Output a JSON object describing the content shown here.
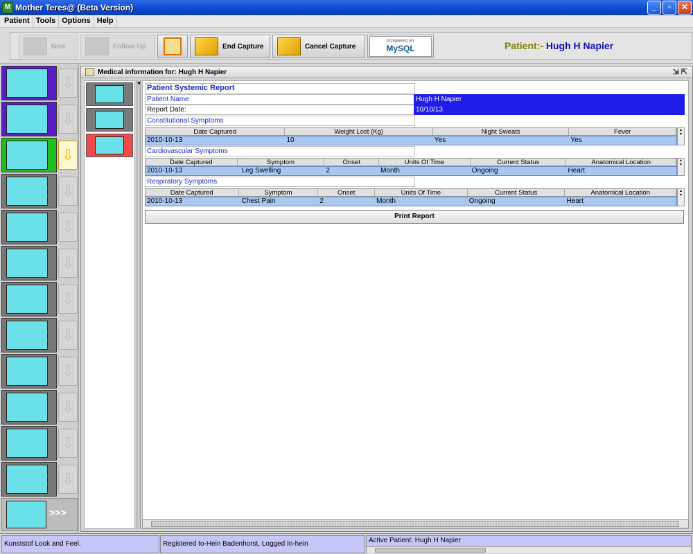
{
  "window": {
    "title": "Mother Teres@ (Beta Version)"
  },
  "menu": [
    "Patient",
    "Tools",
    "Options",
    "Help"
  ],
  "toolbar": {
    "new_label": "New",
    "follow_up_label": "Follow Up",
    "end_capture_label": "End Capture",
    "cancel_capture_label": "Cancel Capture",
    "mysql_powered": "POWERED BY",
    "mysql_label": "MySQL"
  },
  "patient_header": {
    "label": "Patient:-",
    "name": "Hugh H Napier"
  },
  "frame": {
    "title": "Medical information for: Hugh H Napier"
  },
  "report": {
    "title": "Patient Systemic Report",
    "patient_name_label": "Patient Name",
    "patient_name_value": "Hugh H Napier",
    "report_date_label": "Report Date:",
    "report_date_value": "10/10/13",
    "constitutional": {
      "label": "Constitutional Symptoms",
      "headers": [
        "Date Captured",
        "Weight Lost (Kg)",
        "Night Sweats",
        "Fever"
      ],
      "row": [
        "2010-10-13",
        "10",
        "Yes",
        "Yes"
      ]
    },
    "cardiovascular": {
      "label": "Cardiovascular Symptoms",
      "headers": [
        "Date Captured",
        "Symptom",
        "Onset",
        "Units Of Time",
        "Current Status",
        "Anatomical Location"
      ],
      "row": [
        "2010-10-13",
        "Leg Swelling",
        "2",
        "Month",
        "Ongoing",
        "Heart"
      ]
    },
    "respiratory": {
      "label": "Respiratory Symptoms",
      "headers": [
        "Date Captured",
        "Symptom",
        "Onset",
        "Units Of Time",
        "Current Status",
        "Anatomical Location"
      ],
      "row": [
        "2010-10-13",
        "Chest Pain",
        "2",
        "Month",
        "Ongoing",
        "Heart"
      ]
    },
    "print_label": "Print Report"
  },
  "nav": {
    "more_label": ">>>"
  },
  "status": {
    "look_and_feel": "Kunststof Look and Feel.",
    "registered": "Registered to-Hein Badenhorst, Logged In-hein",
    "active_patient": "Active Patient: Hugh H Napier"
  }
}
